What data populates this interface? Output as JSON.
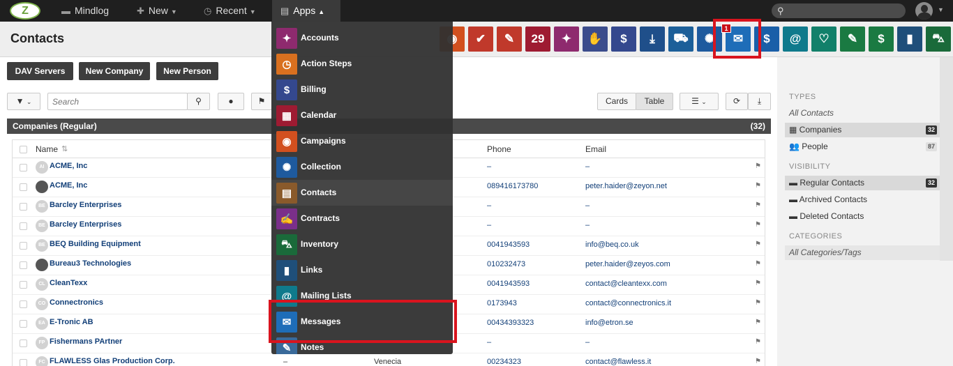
{
  "topbar": {
    "logo_text": "Z",
    "nav": [
      {
        "label": "Mindlog",
        "icon": "mindlog-icon"
      },
      {
        "label": "New",
        "icon": "plus-icon"
      },
      {
        "label": "Recent",
        "icon": "history-icon"
      },
      {
        "label": "Apps",
        "icon": "apps-icon"
      }
    ],
    "search_icon": "⚲"
  },
  "page": {
    "title": "Contacts"
  },
  "app_bar": {
    "apps": [
      {
        "icon": "campaigns-icon",
        "color": "#d2501f",
        "glyph": "◉"
      },
      {
        "icon": "approval-icon",
        "color": "#c0392b",
        "glyph": "✔"
      },
      {
        "icon": "document-icon",
        "color": "#c0392b",
        "glyph": "✎"
      },
      {
        "icon": "calendar-icon",
        "color": "#9e1b32",
        "glyph": "29"
      },
      {
        "icon": "cashier-icon",
        "color": "#8e2a6e",
        "glyph": "✦"
      },
      {
        "icon": "handshake-icon",
        "color": "#3b4c8c",
        "glyph": "✋"
      },
      {
        "icon": "billing-icon",
        "color": "#34488e",
        "glyph": "$"
      },
      {
        "icon": "download-icon",
        "color": "#1f4f8a",
        "glyph": "⤓"
      },
      {
        "icon": "truck-icon",
        "color": "#1c5f99",
        "glyph": "⛟"
      },
      {
        "icon": "collection-icon",
        "color": "#1e5a9e",
        "glyph": "✺"
      },
      {
        "icon": "messages-icon",
        "color": "#1e6db8",
        "glyph": "✉"
      },
      {
        "icon": "money-bag-icon",
        "color": "#1a5fa8",
        "glyph": "$"
      },
      {
        "icon": "mailing-lists-icon",
        "color": "#0f7a8c",
        "glyph": "@"
      },
      {
        "icon": "dental-icon",
        "color": "#12806a",
        "glyph": "♡"
      },
      {
        "icon": "edit-list-icon",
        "color": "#1a7a42",
        "glyph": "✎"
      },
      {
        "icon": "coins-icon",
        "color": "#1a7a42",
        "glyph": "$"
      },
      {
        "icon": "bookmark-icon",
        "color": "#1f4f7a",
        "glyph": "▮"
      },
      {
        "icon": "cart-icon",
        "color": "#1a6a3a",
        "glyph": "⛍"
      }
    ],
    "messages_badge": "1"
  },
  "actions": {
    "dav": "DAV Servers",
    "new_company": "New Company",
    "new_person": "New Person"
  },
  "toolbar": {
    "search_placeholder": "Search",
    "view_cards": "Cards",
    "view_table": "Table"
  },
  "panel": {
    "title": "Companies (Regular)",
    "count": "(32)"
  },
  "table": {
    "columns": {
      "name": "Name",
      "phone": "Phone",
      "email": "Email"
    },
    "rows": [
      {
        "avatar": "AI",
        "photo": false,
        "name": "ACME, Inc",
        "country": "",
        "city": "",
        "phone": "–",
        "email": "–"
      },
      {
        "avatar": "",
        "photo": true,
        "name": "ACME, Inc",
        "country": "",
        "city": "",
        "phone": "089416173780",
        "email": "peter.haider@zeyon.net"
      },
      {
        "avatar": "BE",
        "photo": false,
        "name": "Barcley Enterprises",
        "country": "",
        "city": "",
        "phone": "–",
        "email": "–"
      },
      {
        "avatar": "BE",
        "photo": false,
        "name": "Barcley Enterprises",
        "country": "",
        "city": "",
        "phone": "–",
        "email": "–"
      },
      {
        "avatar": "BE",
        "photo": false,
        "name": "BEQ Building Equipment",
        "country": "",
        "city": "",
        "phone": "0041943593",
        "email": "info@beq.co.uk"
      },
      {
        "avatar": "",
        "photo": true,
        "name": "Bureau3 Technologies",
        "country": "",
        "city": "",
        "phone": "010232473",
        "email": "peter.haider@zeyos.com"
      },
      {
        "avatar": "CL",
        "photo": false,
        "name": "CleanTexx",
        "country": "",
        "city": "",
        "phone": "0041943593",
        "email": "contact@cleantexx.com"
      },
      {
        "avatar": "CO",
        "photo": false,
        "name": "Connectronics",
        "country": "",
        "city": "",
        "phone": "0173943",
        "email": "contact@connectronics.it"
      },
      {
        "avatar": "EA",
        "photo": false,
        "name": "E-Tronic AB",
        "country": "",
        "city": "",
        "phone": "00434393323",
        "email": "info@etron.se"
      },
      {
        "avatar": "FP",
        "photo": false,
        "name": "Fishermans PArtner",
        "country": "",
        "city": "",
        "phone": "–",
        "email": "–"
      },
      {
        "avatar": "FC",
        "photo": false,
        "name": "FLAWLESS Glas Production Corp.",
        "country": "–",
        "city": "Venecia",
        "phone": "00234323",
        "email": "contact@flawless.it"
      }
    ]
  },
  "sidebar": {
    "types_heading": "TYPES",
    "all_contacts": "All Contacts",
    "companies": "Companies",
    "companies_count": "32",
    "people": "People",
    "people_count": "87",
    "visibility_heading": "VISIBILITY",
    "regular": "Regular Contacts",
    "regular_count": "32",
    "archived": "Archived Contacts",
    "deleted": "Deleted Contacts",
    "categories_heading": "CATEGORIES",
    "all_categories": "All Categories/Tags"
  },
  "apps_menu": {
    "items": [
      {
        "label": "Accounts",
        "icon": "accounts-icon",
        "color": "#8e2a6e",
        "glyph": "✦"
      },
      {
        "label": "Action Steps",
        "icon": "stopwatch-icon",
        "color": "#d9701f",
        "glyph": "◷"
      },
      {
        "label": "Billing",
        "icon": "billing-icon",
        "color": "#34488e",
        "glyph": "$"
      },
      {
        "label": "Calendar",
        "icon": "calendar-icon",
        "color": "#9e1b32",
        "glyph": "▦"
      },
      {
        "label": "Campaigns",
        "icon": "campaigns-icon",
        "color": "#d2501f",
        "glyph": "◉"
      },
      {
        "label": "Collection",
        "icon": "collection-icon",
        "color": "#1e5a9e",
        "glyph": "✺"
      },
      {
        "label": "Contacts",
        "icon": "contacts-icon",
        "color": "#8a5a2b",
        "glyph": "▤"
      },
      {
        "label": "Contracts",
        "icon": "contracts-icon",
        "color": "#7a2f8a",
        "glyph": "✍"
      },
      {
        "label": "Inventory",
        "icon": "inventory-icon",
        "color": "#1a6a3a",
        "glyph": "⛍"
      },
      {
        "label": "Links",
        "icon": "bookmark-icon",
        "color": "#1f4f7a",
        "glyph": "▮"
      },
      {
        "label": "Mailing Lists",
        "icon": "mailing-lists-icon",
        "color": "#0f7a8c",
        "glyph": "@"
      },
      {
        "label": "Messages",
        "icon": "messages-icon",
        "color": "#1e6db8",
        "glyph": "✉"
      },
      {
        "label": "Notes",
        "icon": "notes-icon",
        "color": "#3a6a9a",
        "glyph": "✎"
      }
    ]
  }
}
